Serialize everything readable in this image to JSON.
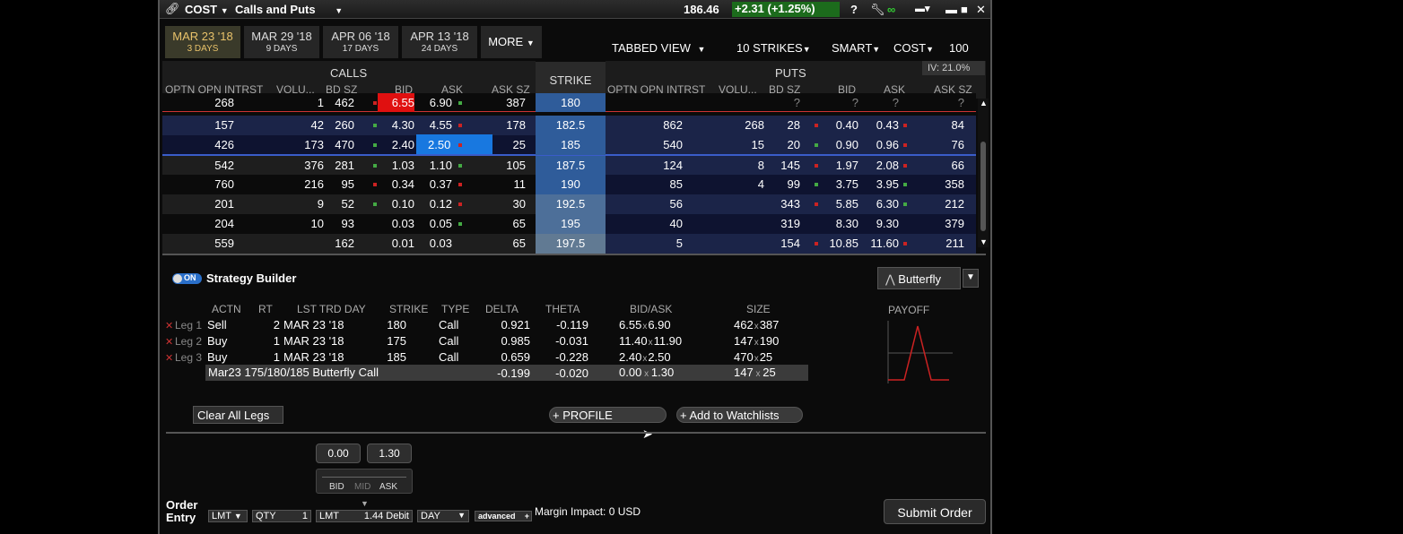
{
  "title": {
    "symbol": "COST",
    "view": "Calls and Puts",
    "price": "186.46",
    "change": "+2.31 (+1.25%)"
  },
  "tabs": [
    {
      "label": "MAR 23 '18",
      "sub": "3 DAYS"
    },
    {
      "label": "MAR 29 '18",
      "sub": "9 DAYS"
    },
    {
      "label": "APR 06 '18",
      "sub": "17 DAYS"
    },
    {
      "label": "APR 13 '18",
      "sub": "24 DAYS"
    },
    {
      "label": "MORE"
    }
  ],
  "options_bar": {
    "view": "TABBED VIEW",
    "strikes": "10 STRIKES",
    "exchange": "SMART",
    "underlying": "COST",
    "multiplier": "100"
  },
  "iv": "IV: 21.0%",
  "headers": {
    "calls": "CALLS",
    "puts": "PUTS",
    "strike": "STRIKE",
    "calls_cols": [
      "OPTN OPN INTRST",
      "VOLU...",
      "BD SZ",
      "BID",
      "ASK",
      "ASK SZ"
    ],
    "puts_cols": [
      "OPTN OPN INTRST",
      "VOLU...",
      "BD SZ",
      "BID",
      "ASK",
      "ASK SZ"
    ]
  },
  "rows": [
    {
      "c_oi": "268",
      "c_vol": "1",
      "c_bsz": "462",
      "c_bid": "6.55",
      "c_ask": "6.90",
      "c_asz": "387",
      "strike": "180",
      "p_oi": "",
      "p_vol": "",
      "p_bsz": "?",
      "p_bid": "?",
      "p_ask": "?",
      "p_asz": "?"
    },
    {
      "c_oi": "157",
      "c_vol": "42",
      "c_bsz": "260",
      "c_bid": "4.30",
      "c_ask": "4.55",
      "c_asz": "178",
      "strike": "182.5",
      "p_oi": "862",
      "p_vol": "268",
      "p_bsz": "28",
      "p_bid": "0.40",
      "p_ask": "0.43",
      "p_asz": "84"
    },
    {
      "c_oi": "426",
      "c_vol": "173",
      "c_bsz": "470",
      "c_bid": "2.40",
      "c_ask": "2.50",
      "c_asz": "25",
      "strike": "185",
      "p_oi": "540",
      "p_vol": "15",
      "p_bsz": "20",
      "p_bid": "0.90",
      "p_ask": "0.96",
      "p_asz": "76"
    },
    {
      "c_oi": "542",
      "c_vol": "376",
      "c_bsz": "281",
      "c_bid": "1.03",
      "c_ask": "1.10",
      "c_asz": "105",
      "strike": "187.5",
      "p_oi": "124",
      "p_vol": "8",
      "p_bsz": "145",
      "p_bid": "1.97",
      "p_ask": "2.08",
      "p_asz": "66"
    },
    {
      "c_oi": "760",
      "c_vol": "216",
      "c_bsz": "95",
      "c_bid": "0.34",
      "c_ask": "0.37",
      "c_asz": "11",
      "strike": "190",
      "p_oi": "85",
      "p_vol": "4",
      "p_bsz": "99",
      "p_bid": "3.75",
      "p_ask": "3.95",
      "p_asz": "358"
    },
    {
      "c_oi": "201",
      "c_vol": "9",
      "c_bsz": "52",
      "c_bid": "0.10",
      "c_ask": "0.12",
      "c_asz": "30",
      "strike": "192.5",
      "p_oi": "56",
      "p_vol": "",
      "p_bsz": "343",
      "p_bid": "5.85",
      "p_ask": "6.30",
      "p_asz": "212"
    },
    {
      "c_oi": "204",
      "c_vol": "10",
      "c_bsz": "93",
      "c_bid": "0.03",
      "c_ask": "0.05",
      "c_asz": "65",
      "strike": "195",
      "p_oi": "40",
      "p_vol": "",
      "p_bsz": "319",
      "p_bid": "8.30",
      "p_ask": "9.30",
      "p_asz": "379"
    },
    {
      "c_oi": "559",
      "c_vol": "",
      "c_bsz": "162",
      "c_bid": "0.01",
      "c_ask": "0.03",
      "c_asz": "65",
      "strike": "197.5",
      "p_oi": "5",
      "p_vol": "",
      "p_bsz": "154",
      "p_bid": "10.85",
      "p_ask": "11.60",
      "p_asz": "211"
    }
  ],
  "strategy": {
    "toggle": "ON",
    "title": "Strategy Builder",
    "preset": "Butterfly",
    "cols": [
      "ACTN",
      "RT",
      "LST TRD DAY",
      "STRIKE",
      "TYPE",
      "DELTA",
      "THETA",
      "BID/ASK",
      "SIZE"
    ],
    "legs": [
      {
        "leg": "Leg 1",
        "actn": "Sell",
        "rt": "2",
        "day": "MAR 23 '18",
        "strike": "180",
        "type": "Call",
        "delta": "0.921",
        "theta": "-0.119",
        "bid": "6.55",
        "ask": "6.90",
        "bsz": "462",
        "asz": "387"
      },
      {
        "leg": "Leg 2",
        "actn": "Buy",
        "rt": "1",
        "day": "MAR 23 '18",
        "strike": "175",
        "type": "Call",
        "delta": "0.985",
        "theta": "-0.031",
        "bid": "11.40",
        "ask": "11.90",
        "bsz": "147",
        "asz": "190"
      },
      {
        "leg": "Leg 3",
        "actn": "Buy",
        "rt": "1",
        "day": "MAR 23 '18",
        "strike": "185",
        "type": "Call",
        "delta": "0.659",
        "theta": "-0.228",
        "bid": "2.40",
        "ask": "2.50",
        "bsz": "470",
        "asz": "25"
      }
    ],
    "summary": {
      "name": "Mar23 175/180/185 Butterfly Call",
      "delta": "-0.199",
      "theta": "-0.020",
      "bid": "0.00",
      "ask": "1.30",
      "bsz": "147",
      "asz": "25"
    },
    "payoff": "PAYOFF",
    "clear": "Clear All Legs",
    "profile": "PROFILE",
    "watch": "Add to Watchlists"
  },
  "order": {
    "bid_val": "0.00",
    "ask_val": "1.30",
    "slider": {
      "bid": "BID",
      "mid": "MID",
      "ask": "ASK"
    },
    "label": "Order Entry",
    "type": "LMT",
    "qty_label": "QTY",
    "qty": "1",
    "price_type": "LMT",
    "price": "1.44 Debit",
    "tif": "DAY",
    "advanced": "advanced",
    "margin": "Margin Impact: 0 USD",
    "submit": "Submit Order"
  }
}
